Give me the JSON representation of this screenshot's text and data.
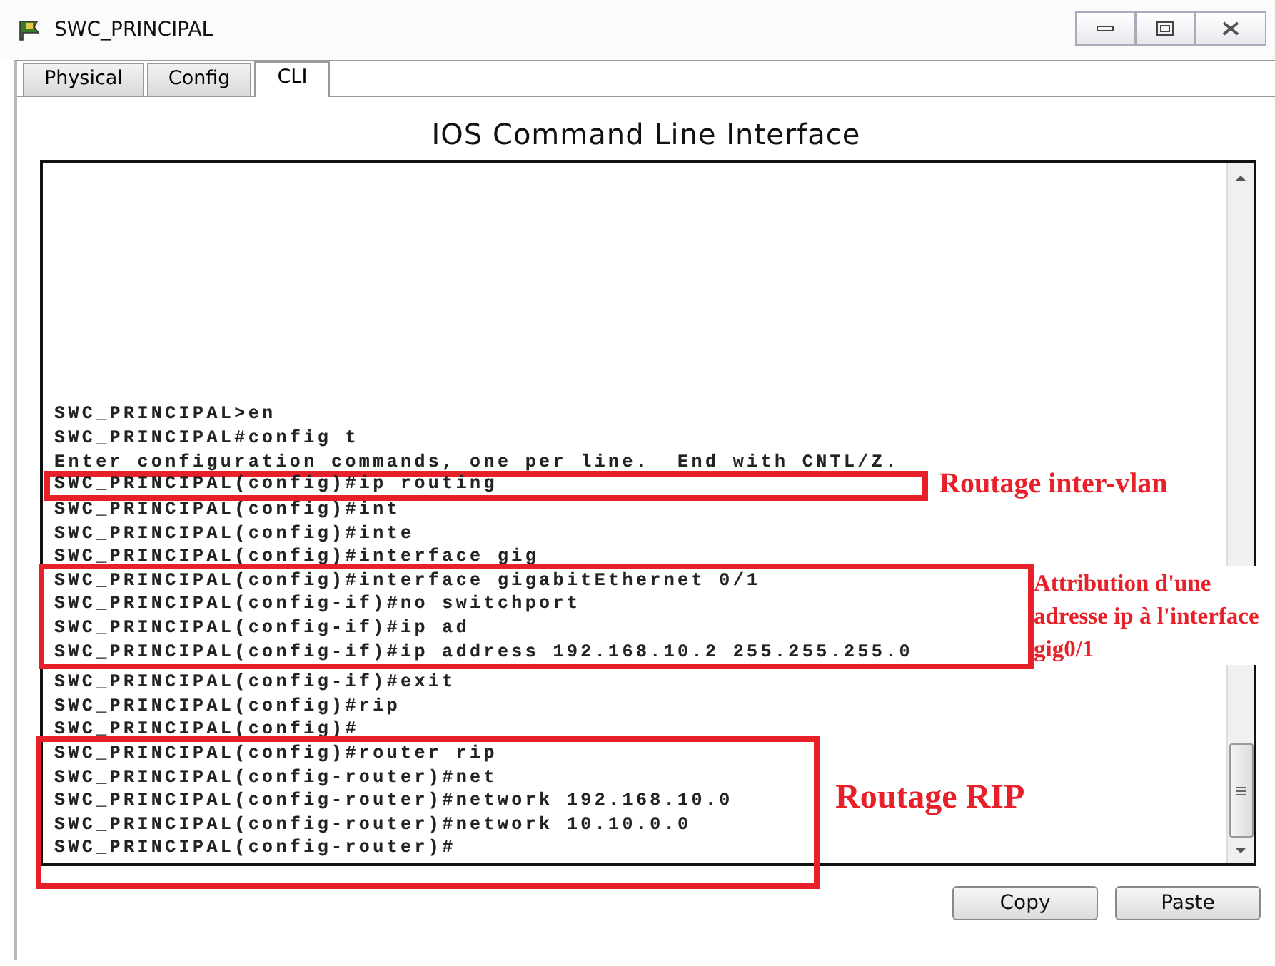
{
  "window": {
    "title": "SWC_PRINCIPAL"
  },
  "tabs": [
    {
      "label": "Physical",
      "selected": false
    },
    {
      "label": "Config",
      "selected": false
    },
    {
      "label": "CLI",
      "selected": true
    }
  ],
  "heading": "IOS Command Line Interface",
  "cli": {
    "output": [
      {
        "kind": "line",
        "text": "SWC_PRINCIPAL>en"
      },
      {
        "kind": "line",
        "text": "SWC_PRINCIPAL#config t"
      },
      {
        "kind": "line",
        "text": "Enter configuration commands, one per line.  End with CNTL/Z."
      },
      {
        "kind": "annotation",
        "note": "Routage inter-vlan",
        "lines": [
          "SWC_PRINCIPAL(config)#ip routing"
        ]
      },
      {
        "kind": "line",
        "text": "SWC_PRINCIPAL(config)#int"
      },
      {
        "kind": "line",
        "text": "SWC_PRINCIPAL(config)#inte"
      },
      {
        "kind": "line",
        "text": "SWC_PRINCIPAL(config)#interface gig"
      },
      {
        "kind": "annotation",
        "note": "Attribution d'une adresse ip à l'interface gig0/1",
        "lines": [
          "SWC_PRINCIPAL(config)#interface gigabitEthernet 0/1",
          "SWC_PRINCIPAL(config-if)#no switchport",
          "SWC_PRINCIPAL(config-if)#ip ad",
          "SWC_PRINCIPAL(config-if)#ip address 192.168.10.2 255.255.255.0"
        ]
      },
      {
        "kind": "line",
        "text": "SWC_PRINCIPAL(config-if)#exit"
      },
      {
        "kind": "line",
        "text": "SWC_PRINCIPAL(config)#rip"
      },
      {
        "kind": "line",
        "text": "SWC_PRINCIPAL(config)#"
      },
      {
        "kind": "annotation",
        "note": "Routage RIP",
        "lines": [
          "SWC_PRINCIPAL(config)#router rip",
          "SWC_PRINCIPAL(config-router)#net",
          "SWC_PRINCIPAL(config-router)#network 192.168.10.0",
          "SWC_PRINCIPAL(config-router)#network 10.10.0.0",
          "SWC_PRINCIPAL(config-router)#"
        ]
      }
    ]
  },
  "buttons": [
    "Copy",
    "Paste"
  ]
}
